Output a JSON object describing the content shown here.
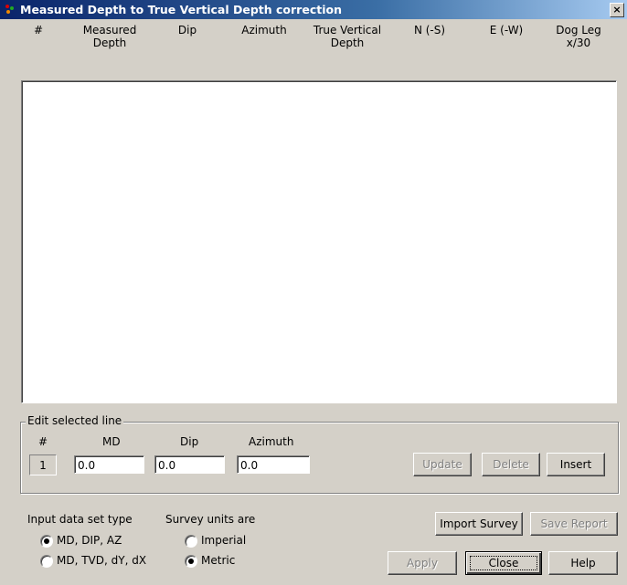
{
  "window": {
    "title": "Measured Depth to True Vertical Depth correction",
    "close_glyph": "×"
  },
  "columns": [
    "#",
    "Measured\nDepth",
    "Dip",
    "Azimuth",
    "True Vertical\nDepth",
    "N (-S)",
    "E (-W)",
    "Dog Leg\nx/30"
  ],
  "rows": [],
  "edit": {
    "group_label": "Edit selected line",
    "headers": {
      "num": "#",
      "md": "MD",
      "dip": "Dip",
      "azimuth": "Azimuth"
    },
    "row_number": "1",
    "md": "0.0",
    "dip": "0.0",
    "azimuth": "0.0",
    "buttons": {
      "update": "Update",
      "delete": "Delete",
      "insert": "Insert"
    }
  },
  "input_type": {
    "label": "Input data set type",
    "options": [
      "MD, DIP, AZ",
      "MD, TVD, dY, dX"
    ],
    "selected": 0
  },
  "units": {
    "label": "Survey units are",
    "options": [
      "Imperial",
      "Metric"
    ],
    "selected": 1
  },
  "actions": {
    "import": "Import Survey",
    "save": "Save Report",
    "apply": "Apply",
    "close": "Close",
    "help": "Help"
  },
  "icons": {
    "app": "app-icon",
    "close": "close-icon"
  }
}
